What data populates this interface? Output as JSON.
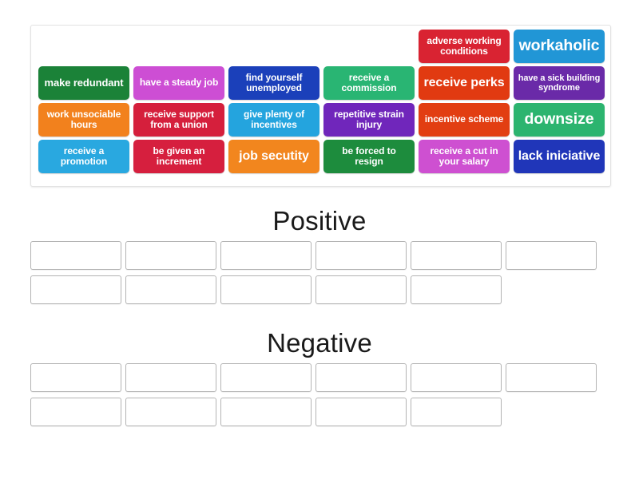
{
  "activity": {
    "tile_bank": {
      "rows": [
        [
          {
            "label": "",
            "color": "transparent",
            "size": "fs-12",
            "blank": true
          },
          {
            "label": "",
            "color": "transparent",
            "size": "fs-12",
            "blank": true
          },
          {
            "label": "",
            "color": "transparent",
            "size": "fs-12",
            "blank": true
          },
          {
            "label": "",
            "color": "transparent",
            "size": "fs-12",
            "blank": true
          },
          {
            "label": "adverse working conditions",
            "color": "#d92332",
            "size": "fs-12"
          },
          {
            "label": "workaholic",
            "color": "#2196d6",
            "size": "fs-19"
          }
        ],
        [
          {
            "label": "make redundant",
            "color": "#1b8238",
            "size": "fs-13"
          },
          {
            "label": "have a steady job",
            "color": "#cd4ed4",
            "size": "fs-12"
          },
          {
            "label": "find yourself unemployed",
            "color": "#1b40ba",
            "size": "fs-12"
          },
          {
            "label": "receive a commission",
            "color": "#29b573",
            "size": "fs-12"
          },
          {
            "label": "receive perks",
            "color": "#e13a11",
            "size": "fs-16"
          },
          {
            "label": "have a sick building syndrome",
            "color": "#6a2aa8",
            "size": "fs-11"
          }
        ],
        [
          {
            "label": "work unsociable hours",
            "color": "#f2811d",
            "size": "fs-12"
          },
          {
            "label": "receive support from a union",
            "color": "#d51f3c",
            "size": "fs-12"
          },
          {
            "label": "give plenty of incentives",
            "color": "#24a4de",
            "size": "fs-12"
          },
          {
            "label": "repetitive strain injury",
            "color": "#7026bb",
            "size": "fs-12"
          },
          {
            "label": "incentive scheme",
            "color": "#e23e12",
            "size": "fs-12"
          },
          {
            "label": "downsize",
            "color": "#2cb46f",
            "size": "fs-19"
          }
        ],
        [
          {
            "label": "receive a promotion",
            "color": "#29a8e0",
            "size": "fs-12"
          },
          {
            "label": "be given an increment",
            "color": "#d61f3e",
            "size": "fs-12"
          },
          {
            "label": "job secutity",
            "color": "#f2861e",
            "size": "fs-16"
          },
          {
            "label": "be forced to resign",
            "color": "#1d8c3d",
            "size": "fs-12"
          },
          {
            "label": "receive a cut in your salary",
            "color": "#ce50d1",
            "size": "fs-12"
          },
          {
            "label": "lack iniciative",
            "color": "#2036b9",
            "size": "fs-16"
          }
        ]
      ]
    },
    "categories": [
      {
        "title": "Positive",
        "zone_rows": [
          6,
          5
        ]
      },
      {
        "title": "Negative",
        "zone_rows": [
          6,
          5
        ]
      }
    ]
  }
}
